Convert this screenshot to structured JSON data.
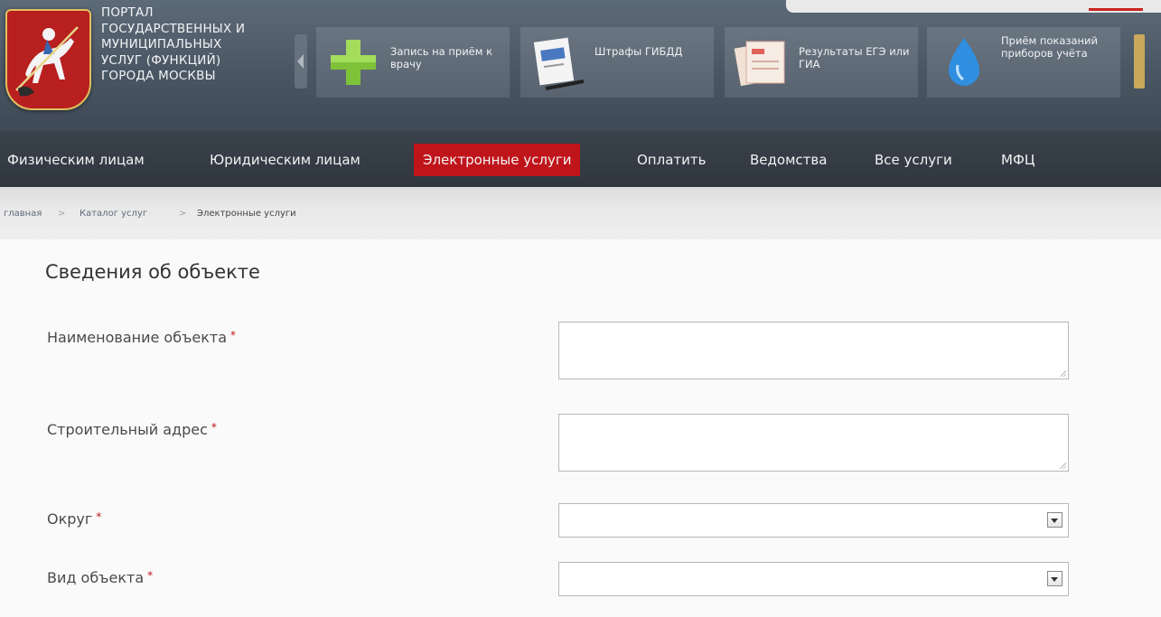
{
  "header": {
    "portal_title": "ПОРТАЛ\nГОСУДАРСТВЕННЫХ И\nМУНИЦИПАЛЬНЫХ\nУСЛУГ (ФУНКЦИЙ)\nГОРОДА МОСКВЫ",
    "quick_tiles": [
      {
        "label": "Запись на приём к врачу",
        "icon": "green-cross-icon"
      },
      {
        "label": "Штрафы ГИБДД",
        "icon": "document-pen-icon"
      },
      {
        "label": "Результаты ЕГЭ или ГИА",
        "icon": "exam-papers-icon"
      },
      {
        "label": "Приём показаний приборов учёта",
        "icon": "water-drop-icon"
      }
    ]
  },
  "nav": {
    "items": [
      "Физическим лицам",
      "Юридическим лицам",
      "Электронные услуги",
      "Оплатить",
      "Ведомства",
      "Все услуги",
      "МФЦ"
    ],
    "active_index": 2
  },
  "breadcrumb": {
    "items": [
      "главная",
      "Каталог услуг",
      "Электронные услуги"
    ],
    "separator": ">"
  },
  "form": {
    "section_title": "Сведения об объекте",
    "required_mark": "*",
    "fields": [
      {
        "label": "Наименование объекта",
        "type": "textarea",
        "value": ""
      },
      {
        "label": "Строительный адрес",
        "type": "textarea",
        "value": ""
      },
      {
        "label": "Округ",
        "type": "select",
        "value": ""
      },
      {
        "label": "Вид объекта",
        "type": "select",
        "value": ""
      }
    ]
  },
  "colors": {
    "header_bg": "#4a5663",
    "nav_bg": "#2f363f",
    "active_red": "#c0141b",
    "coat_red": "#b81f1f"
  }
}
